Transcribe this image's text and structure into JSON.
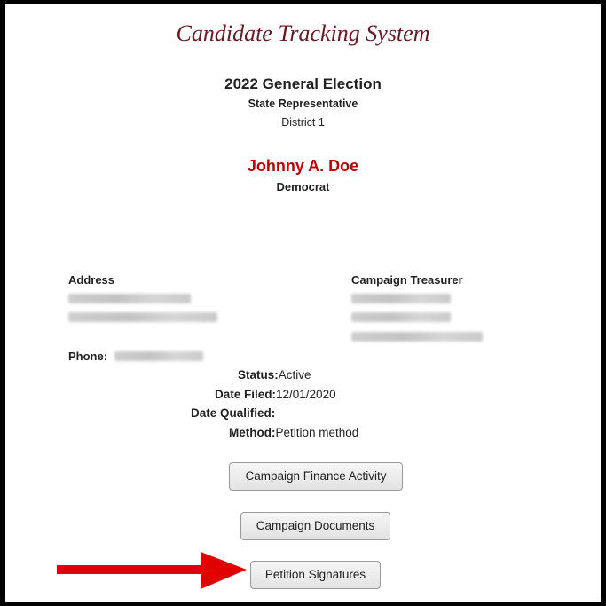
{
  "app": {
    "title": "Candidate Tracking System"
  },
  "election": {
    "name": "2022 General Election",
    "office": "State Representative",
    "district": "District 1"
  },
  "candidate": {
    "name": "Johnny A. Doe",
    "party": "Democrat"
  },
  "contact": {
    "address_label": "Address",
    "treasurer_label": "Campaign Treasurer",
    "phone_label": "Phone:"
  },
  "details": {
    "status_label": "Status:",
    "status_value": "Active",
    "date_filed_label": "Date Filed:",
    "date_filed_value": "12/01/2020",
    "date_qualified_label": "Date Qualified:",
    "date_qualified_value": "",
    "method_label": "Method:",
    "method_value": "Petition method"
  },
  "buttons": {
    "finance": "Campaign Finance Activity",
    "documents": "Campaign Documents",
    "petition": "Petition Signatures"
  },
  "colors": {
    "title": "#6b1a22",
    "candidate_name": "#c00000",
    "arrow": "#e00000"
  }
}
